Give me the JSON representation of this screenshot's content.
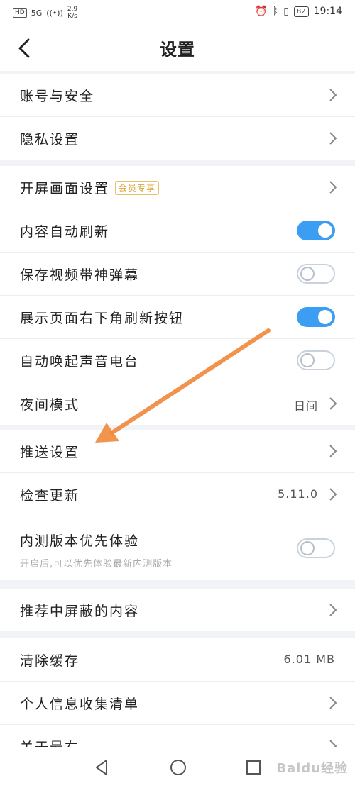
{
  "status_bar": {
    "network_hd": "HD",
    "network_5g": "5G",
    "speed": "2.9",
    "speed_unit": "K/s",
    "battery": "82",
    "time": "19:14"
  },
  "header": {
    "title": "设置"
  },
  "group1": {
    "account_security": "账号与安全",
    "privacy_settings": "隐私设置"
  },
  "group2": {
    "splash_settings": "开屏画面设置",
    "vip_badge": "会员专享",
    "auto_refresh": "内容自动刷新",
    "auto_refresh_on": true,
    "save_video_danmaku": "保存视频带神弹幕",
    "save_video_danmaku_on": false,
    "show_refresh_button": "展示页面右下角刷新按钮",
    "show_refresh_button_on": true,
    "auto_radio": "自动唤起声音电台",
    "auto_radio_on": false,
    "night_mode": "夜间模式",
    "night_mode_value": "日间"
  },
  "group3": {
    "push_settings": "推送设置",
    "check_update": "检查更新",
    "version": "5.11.0",
    "beta_experience": "内测版本优先体验",
    "beta_subtitle": "开启后,可以优先体验最新内测版本",
    "beta_on": false
  },
  "group4": {
    "blocked_content": "推荐中屏蔽的内容"
  },
  "group5": {
    "clear_cache": "清除缓存",
    "cache_size": "6.01 MB",
    "personal_info_list": "个人信息收集清单",
    "about": "关于最右"
  },
  "watermark": "Baidu经验",
  "colors": {
    "accent": "#3c9ef3",
    "arrow": "#f0883a",
    "vip": "#d6a53a"
  }
}
